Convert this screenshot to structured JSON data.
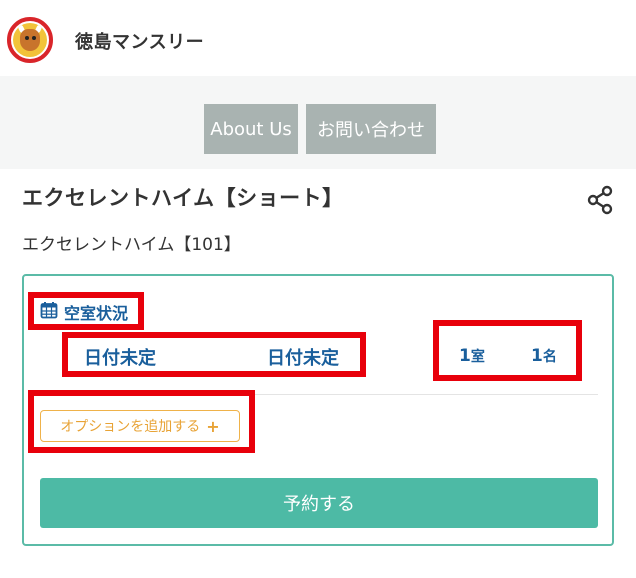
{
  "header": {
    "site_name": "徳島マンスリー",
    "logo_icon": "bull-mascot-logo"
  },
  "nav": {
    "about_label": "About Us",
    "contact_label": "お問い合わせ"
  },
  "property": {
    "title": "エクセレントハイム【ショート】",
    "subtitle": "エクセレントハイム【101】",
    "share_icon": "share-icon"
  },
  "booking": {
    "availability_label": "空室状況",
    "calendar_icon": "calendar-icon",
    "checkin": "日付未定",
    "checkout": "日付未定",
    "rooms_count": "1",
    "rooms_unit": "室",
    "guests_count": "1",
    "guests_unit": "名",
    "option_label": "オプションを追加する",
    "option_plus": "+",
    "reserve_label": "予約する"
  },
  "colors": {
    "accent_teal": "#4dbaa5",
    "link_blue": "#1a5f9c",
    "option_orange": "#e8a336",
    "nav_gray": "#a9b3b1",
    "highlight_red": "#e8000b"
  }
}
